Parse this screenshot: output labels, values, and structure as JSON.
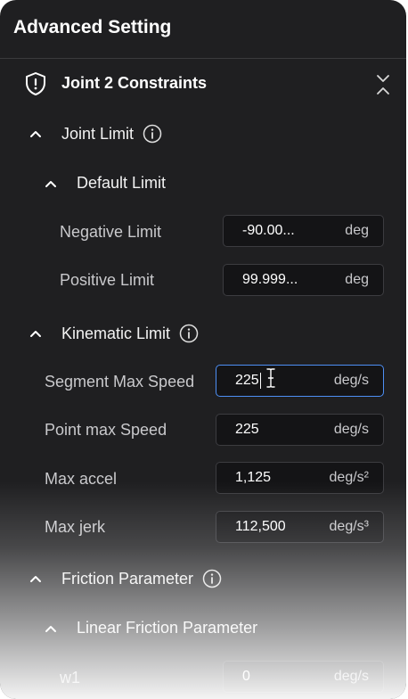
{
  "panel": {
    "title": "Advanced Setting"
  },
  "section": {
    "title": "Joint 2 Constraints",
    "icon": "shield-alert-icon",
    "collapse_icon": "chevrons-collapse-icon"
  },
  "joint_limit": {
    "title": "Joint Limit",
    "default_limit": {
      "title": "Default Limit",
      "negative": {
        "label": "Negative Limit",
        "value": "-90.00...",
        "unit": "deg"
      },
      "positive": {
        "label": "Positive Limit",
        "value": "99.999...",
        "unit": "deg"
      }
    }
  },
  "kinematic_limit": {
    "title": "Kinematic Limit",
    "segment_max_speed": {
      "label": "Segment Max Speed",
      "value": "225",
      "unit": "deg/s"
    },
    "point_max_speed": {
      "label": "Point max Speed",
      "value": "225",
      "unit": "deg/s"
    },
    "max_accel": {
      "label": "Max accel",
      "value": "1,125",
      "unit": "deg/s²"
    },
    "max_jerk": {
      "label": "Max jerk",
      "value": "112,500",
      "unit": "deg/s³"
    }
  },
  "friction": {
    "title": "Friction Parameter",
    "linear": {
      "title": "Linear Friction Parameter",
      "w1": {
        "label": "w1",
        "value": "0",
        "unit": "deg/s"
      }
    }
  },
  "colors": {
    "background": "#1f1f21",
    "field": "#141416",
    "focus": "#4d8ff5"
  }
}
